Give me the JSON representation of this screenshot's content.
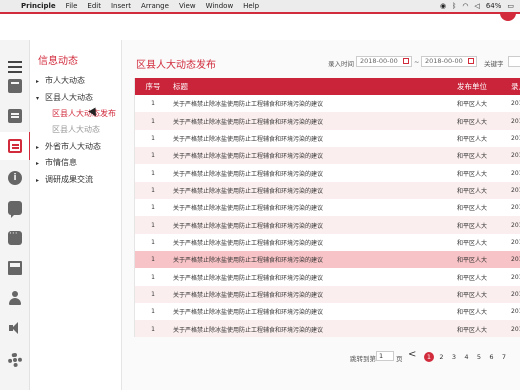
{
  "menubar": {
    "app": "Principle",
    "items": [
      "File",
      "Edit",
      "Insert",
      "Arrange",
      "View",
      "Window",
      "Help"
    ],
    "battery": "64%"
  },
  "tree": {
    "title": "信息动态",
    "items": [
      {
        "label": "市人大动态",
        "arrow": "▸"
      },
      {
        "label": "区县人大动态",
        "arrow": "▾"
      },
      {
        "label": "外省市人大动态",
        "arrow": "▸"
      },
      {
        "label": "市情信息",
        "arrow": "▸"
      },
      {
        "label": "调研成果交流",
        "arrow": "▸"
      }
    ],
    "subitems": [
      {
        "label": "区县人大动态发布",
        "active": true
      },
      {
        "label": "区县人大动态",
        "active": false
      }
    ]
  },
  "main": {
    "title": "区县人大动态发布",
    "filter": {
      "date_label": "录入时间",
      "date_from": "2018-00-00",
      "separator": "~",
      "date_to": "2018-00-00",
      "keyword_label": "关键字"
    },
    "table": {
      "headers": [
        "序号",
        "标题",
        "发布单位",
        "录入"
      ],
      "rows": [
        {
          "no": "1",
          "title": "关于严格禁止除冰盐使用防止工程辅食和环境污染的建议",
          "unit": "和平区人大",
          "date": "201"
        },
        {
          "no": "1",
          "title": "关于严格禁止除冰盐使用防止工程辅食和环境污染的建议",
          "unit": "和平区人大",
          "date": "201"
        },
        {
          "no": "1",
          "title": "关于严格禁止除冰盐使用防止工程辅食和环境污染的建议",
          "unit": "和平区人大",
          "date": "201"
        },
        {
          "no": "1",
          "title": "关于严格禁止除冰盐使用防止工程辅食和环境污染的建议",
          "unit": "和平区人大",
          "date": "201"
        },
        {
          "no": "1",
          "title": "关于严格禁止除冰盐使用防止工程辅食和环境污染的建议",
          "unit": "和平区人大",
          "date": "201"
        },
        {
          "no": "1",
          "title": "关于严格禁止除冰盐使用防止工程辅食和环境污染的建议",
          "unit": "和平区人大",
          "date": "201"
        },
        {
          "no": "1",
          "title": "关于严格禁止除冰盐使用防止工程辅食和环境污染的建议",
          "unit": "和平区人大",
          "date": "201"
        },
        {
          "no": "1",
          "title": "关于严格禁止除冰盐使用防止工程辅食和环境污染的建议",
          "unit": "和平区人大",
          "date": "201"
        },
        {
          "no": "1",
          "title": "关于严格禁止除冰盐使用防止工程辅食和环境污染的建议",
          "unit": "和平区人大",
          "date": "201"
        },
        {
          "no": "1",
          "title": "关于严格禁止除冰盐使用防止工程辅食和环境污染的建议",
          "unit": "和平区人大",
          "date": "201"
        },
        {
          "no": "1",
          "title": "关于严格禁止除冰盐使用防止工程辅食和环境污染的建议",
          "unit": "和平区人大",
          "date": "201"
        },
        {
          "no": "1",
          "title": "关于严格禁止除冰盐使用防止工程辅食和环境污染的建议",
          "unit": "和平区人大",
          "date": "201"
        },
        {
          "no": "1",
          "title": "关于严格禁止除冰盐使用防止工程辅食和环境污染的建议",
          "unit": "和平区人大",
          "date": "201"
        },
        {
          "no": "1",
          "title": "关于严格禁止除冰盐使用防止工程辅食和环境污染的建议",
          "unit": "和平区人大",
          "date": "201"
        }
      ],
      "highlighted_row": 9
    },
    "pagination": {
      "jump_label": "跳转到第",
      "page_value": "1",
      "page_suffix": "页",
      "prev": "<",
      "pages": [
        "1",
        "2",
        "3",
        "4",
        "5",
        "6",
        "7"
      ],
      "current": "1"
    }
  },
  "colors": {
    "accent": "#d12b3c",
    "header": "#c9243a",
    "row_alt": "#fbeeee",
    "row_highlight": "#f7c3c6"
  }
}
